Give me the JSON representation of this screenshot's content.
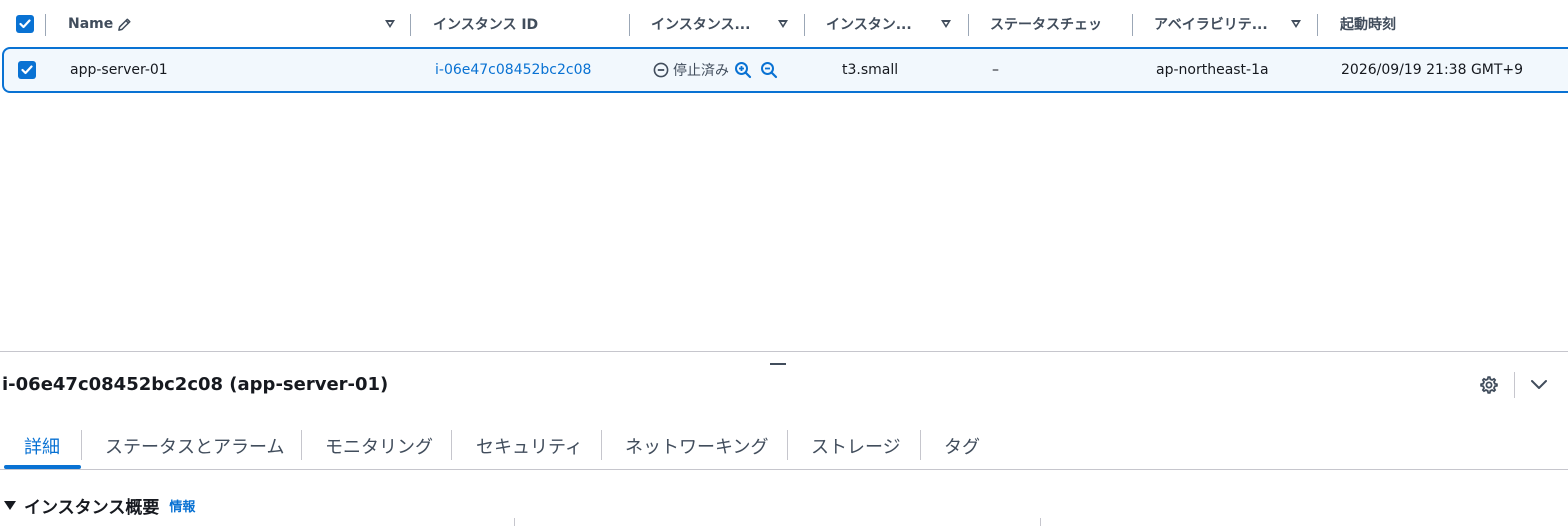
{
  "table": {
    "columns": [
      {
        "label": "Name"
      },
      {
        "label": "インスタンス ID"
      },
      {
        "label": "インスタンス..."
      },
      {
        "label": "インスタン..."
      },
      {
        "label": "ステータスチェッ"
      },
      {
        "label": "アベイラビリテ..."
      },
      {
        "label": "起動時刻"
      }
    ],
    "rows": [
      {
        "selected": true,
        "name": "app-server-01",
        "instance_id": "i-06e47c08452bc2c08",
        "state": "停止済み",
        "instance_type": "t3.small",
        "status_check": "–",
        "availability_zone": "ap-northeast-1a",
        "launch_time": "2026/09/19 21:38 GMT+9"
      }
    ]
  },
  "detail": {
    "title": "i-06e47c08452bc2c08 (app-server-01)",
    "tabs": [
      {
        "label": "詳細",
        "active": true
      },
      {
        "label": "ステータスとアラーム"
      },
      {
        "label": "モニタリング"
      },
      {
        "label": "セキュリティ"
      },
      {
        "label": "ネットワーキング"
      },
      {
        "label": "ストレージ"
      },
      {
        "label": "タグ"
      }
    ],
    "section": {
      "title": "インスタンス概要",
      "info_label": "情報"
    }
  },
  "icons": {
    "select_all": "checkbox-checked-icon",
    "edit": "pencil-icon",
    "sort": "sort-caret-icon",
    "state": "stopped-circle-icon",
    "zoom_in": "zoom-in-icon",
    "zoom_out": "zoom-out-icon",
    "settings": "gear-icon",
    "collapse": "chevron-down-icon",
    "expand_section": "caret-down-icon"
  },
  "colors": {
    "accent": "#0972d3",
    "selected_row_bg": "#f2f8fd",
    "text": "#16191f",
    "muted_text": "#414d5c",
    "divider": "#c6c6cd"
  }
}
